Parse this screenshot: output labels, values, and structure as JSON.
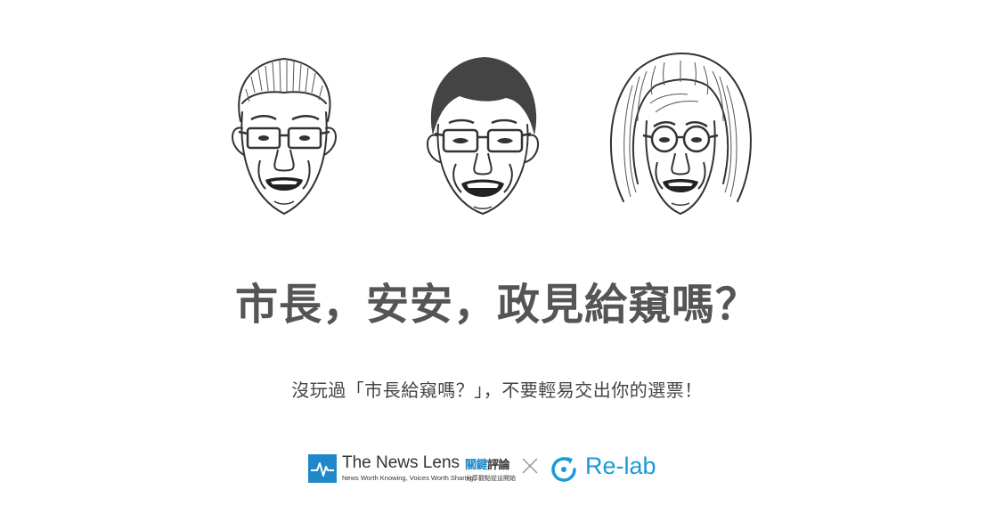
{
  "page": {
    "title": "市長，安安，政見給窺嗎？",
    "subtitle": "沒玩過「市長給窺嗎？」，不要輕易交出你的選票！"
  },
  "faces": [
    {
      "name": "candidate-1-face-icon"
    },
    {
      "name": "candidate-2-face-icon"
    },
    {
      "name": "candidate-3-face-icon"
    }
  ],
  "footer": {
    "partner1": {
      "name": "The News Lens",
      "name_cn_blue": "關鍵",
      "name_cn_dark": "評論",
      "tagline": "News Worth Knowing, Voices Worth Sharing",
      "tagline_cn": "分享觀點從這開始"
    },
    "separator": "×",
    "partner2": {
      "name": "Re-lab"
    }
  },
  "colors": {
    "title": "#555555",
    "accent_blue": "#1e88c8",
    "relab_blue": "#1a9bd7"
  }
}
